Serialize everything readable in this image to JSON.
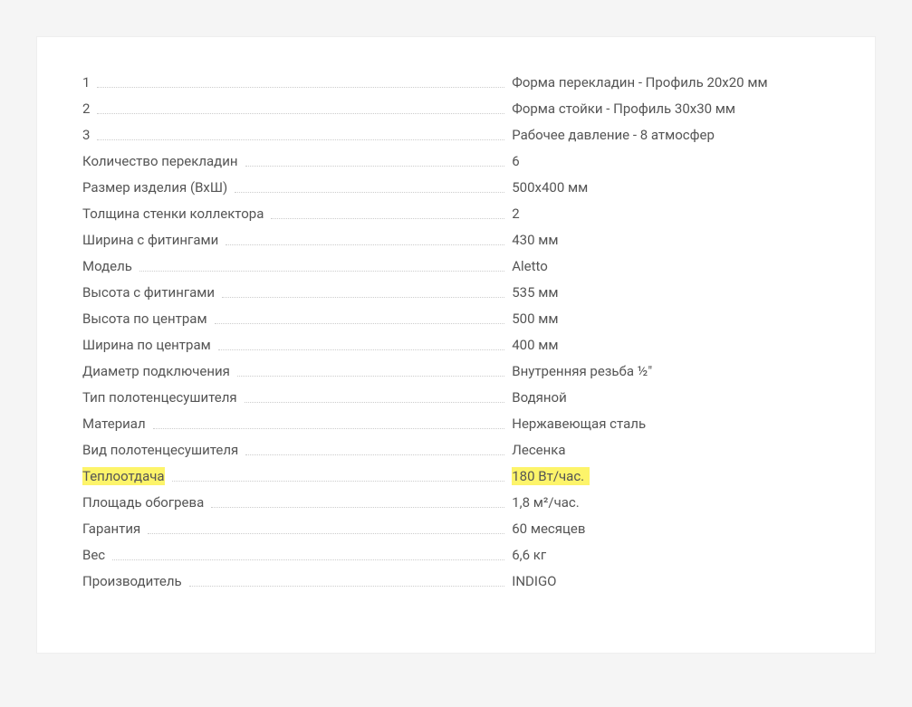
{
  "specs": [
    {
      "label": "1",
      "value": "Форма перекладин - Профиль 20х20 мм",
      "highlight": false
    },
    {
      "label": "2",
      "value": "Форма стойки - Профиль 30х30 мм",
      "highlight": false
    },
    {
      "label": "3",
      "value": "Рабочее давление - 8 атмосфер",
      "highlight": false
    },
    {
      "label": "Количество перекладин",
      "value": "6",
      "highlight": false
    },
    {
      "label": "Размер изделия (ВхШ)",
      "value": "500х400 мм",
      "highlight": false
    },
    {
      "label": "Толщина стенки коллектора",
      "value": "2",
      "highlight": false
    },
    {
      "label": "Ширина с фитингами",
      "value": "430 мм",
      "highlight": false
    },
    {
      "label": "Модель",
      "value": "Aletto",
      "highlight": false
    },
    {
      "label": "Высота с фитингами",
      "value": "535 мм",
      "highlight": false
    },
    {
      "label": "Высота по центрам",
      "value": "500 мм",
      "highlight": false
    },
    {
      "label": "Ширина по центрам",
      "value": "400 мм",
      "highlight": false
    },
    {
      "label": "Диаметр подключения",
      "value": "Внутренняя резьба ½\"",
      "highlight": false
    },
    {
      "label": "Тип полотенцесушителя",
      "value": "Водяной",
      "highlight": false
    },
    {
      "label": "Материал",
      "value": "Нержавеющая сталь",
      "highlight": false
    },
    {
      "label": "Вид полотенцесушителя",
      "value": "Лесенка",
      "highlight": false
    },
    {
      "label": "Теплоотдача",
      "value": "180 Вт/час.",
      "highlight": true
    },
    {
      "label": "Площадь обогрева",
      "value": "1,8 м²/час.",
      "highlight": false
    },
    {
      "label": "Гарантия",
      "value": "60 месяцев",
      "highlight": false
    },
    {
      "label": "Вес",
      "value": "6,6 кг",
      "highlight": false
    },
    {
      "label": "Производитель",
      "value": "INDIGO",
      "highlight": false
    }
  ]
}
